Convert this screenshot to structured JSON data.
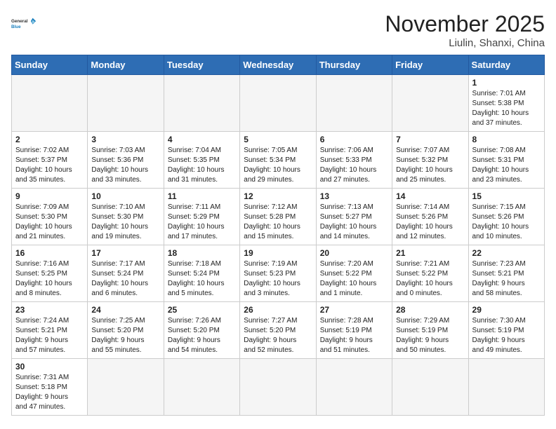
{
  "header": {
    "logo_general": "General",
    "logo_blue": "Blue",
    "month_title": "November 2025",
    "location": "Liulin, Shanxi, China"
  },
  "days_of_week": [
    "Sunday",
    "Monday",
    "Tuesday",
    "Wednesday",
    "Thursday",
    "Friday",
    "Saturday"
  ],
  "weeks": [
    [
      {
        "day": "",
        "info": ""
      },
      {
        "day": "",
        "info": ""
      },
      {
        "day": "",
        "info": ""
      },
      {
        "day": "",
        "info": ""
      },
      {
        "day": "",
        "info": ""
      },
      {
        "day": "",
        "info": ""
      },
      {
        "day": "1",
        "info": "Sunrise: 7:01 AM\nSunset: 5:38 PM\nDaylight: 10 hours\nand 37 minutes."
      }
    ],
    [
      {
        "day": "2",
        "info": "Sunrise: 7:02 AM\nSunset: 5:37 PM\nDaylight: 10 hours\nand 35 minutes."
      },
      {
        "day": "3",
        "info": "Sunrise: 7:03 AM\nSunset: 5:36 PM\nDaylight: 10 hours\nand 33 minutes."
      },
      {
        "day": "4",
        "info": "Sunrise: 7:04 AM\nSunset: 5:35 PM\nDaylight: 10 hours\nand 31 minutes."
      },
      {
        "day": "5",
        "info": "Sunrise: 7:05 AM\nSunset: 5:34 PM\nDaylight: 10 hours\nand 29 minutes."
      },
      {
        "day": "6",
        "info": "Sunrise: 7:06 AM\nSunset: 5:33 PM\nDaylight: 10 hours\nand 27 minutes."
      },
      {
        "day": "7",
        "info": "Sunrise: 7:07 AM\nSunset: 5:32 PM\nDaylight: 10 hours\nand 25 minutes."
      },
      {
        "day": "8",
        "info": "Sunrise: 7:08 AM\nSunset: 5:31 PM\nDaylight: 10 hours\nand 23 minutes."
      }
    ],
    [
      {
        "day": "9",
        "info": "Sunrise: 7:09 AM\nSunset: 5:30 PM\nDaylight: 10 hours\nand 21 minutes."
      },
      {
        "day": "10",
        "info": "Sunrise: 7:10 AM\nSunset: 5:30 PM\nDaylight: 10 hours\nand 19 minutes."
      },
      {
        "day": "11",
        "info": "Sunrise: 7:11 AM\nSunset: 5:29 PM\nDaylight: 10 hours\nand 17 minutes."
      },
      {
        "day": "12",
        "info": "Sunrise: 7:12 AM\nSunset: 5:28 PM\nDaylight: 10 hours\nand 15 minutes."
      },
      {
        "day": "13",
        "info": "Sunrise: 7:13 AM\nSunset: 5:27 PM\nDaylight: 10 hours\nand 14 minutes."
      },
      {
        "day": "14",
        "info": "Sunrise: 7:14 AM\nSunset: 5:26 PM\nDaylight: 10 hours\nand 12 minutes."
      },
      {
        "day": "15",
        "info": "Sunrise: 7:15 AM\nSunset: 5:26 PM\nDaylight: 10 hours\nand 10 minutes."
      }
    ],
    [
      {
        "day": "16",
        "info": "Sunrise: 7:16 AM\nSunset: 5:25 PM\nDaylight: 10 hours\nand 8 minutes."
      },
      {
        "day": "17",
        "info": "Sunrise: 7:17 AM\nSunset: 5:24 PM\nDaylight: 10 hours\nand 6 minutes."
      },
      {
        "day": "18",
        "info": "Sunrise: 7:18 AM\nSunset: 5:24 PM\nDaylight: 10 hours\nand 5 minutes."
      },
      {
        "day": "19",
        "info": "Sunrise: 7:19 AM\nSunset: 5:23 PM\nDaylight: 10 hours\nand 3 minutes."
      },
      {
        "day": "20",
        "info": "Sunrise: 7:20 AM\nSunset: 5:22 PM\nDaylight: 10 hours\nand 1 minute."
      },
      {
        "day": "21",
        "info": "Sunrise: 7:21 AM\nSunset: 5:22 PM\nDaylight: 10 hours\nand 0 minutes."
      },
      {
        "day": "22",
        "info": "Sunrise: 7:23 AM\nSunset: 5:21 PM\nDaylight: 9 hours\nand 58 minutes."
      }
    ],
    [
      {
        "day": "23",
        "info": "Sunrise: 7:24 AM\nSunset: 5:21 PM\nDaylight: 9 hours\nand 57 minutes."
      },
      {
        "day": "24",
        "info": "Sunrise: 7:25 AM\nSunset: 5:20 PM\nDaylight: 9 hours\nand 55 minutes."
      },
      {
        "day": "25",
        "info": "Sunrise: 7:26 AM\nSunset: 5:20 PM\nDaylight: 9 hours\nand 54 minutes."
      },
      {
        "day": "26",
        "info": "Sunrise: 7:27 AM\nSunset: 5:20 PM\nDaylight: 9 hours\nand 52 minutes."
      },
      {
        "day": "27",
        "info": "Sunrise: 7:28 AM\nSunset: 5:19 PM\nDaylight: 9 hours\nand 51 minutes."
      },
      {
        "day": "28",
        "info": "Sunrise: 7:29 AM\nSunset: 5:19 PM\nDaylight: 9 hours\nand 50 minutes."
      },
      {
        "day": "29",
        "info": "Sunrise: 7:30 AM\nSunset: 5:19 PM\nDaylight: 9 hours\nand 49 minutes."
      }
    ],
    [
      {
        "day": "30",
        "info": "Sunrise: 7:31 AM\nSunset: 5:18 PM\nDaylight: 9 hours\nand 47 minutes."
      },
      {
        "day": "",
        "info": ""
      },
      {
        "day": "",
        "info": ""
      },
      {
        "day": "",
        "info": ""
      },
      {
        "day": "",
        "info": ""
      },
      {
        "day": "",
        "info": ""
      },
      {
        "day": "",
        "info": ""
      }
    ]
  ]
}
